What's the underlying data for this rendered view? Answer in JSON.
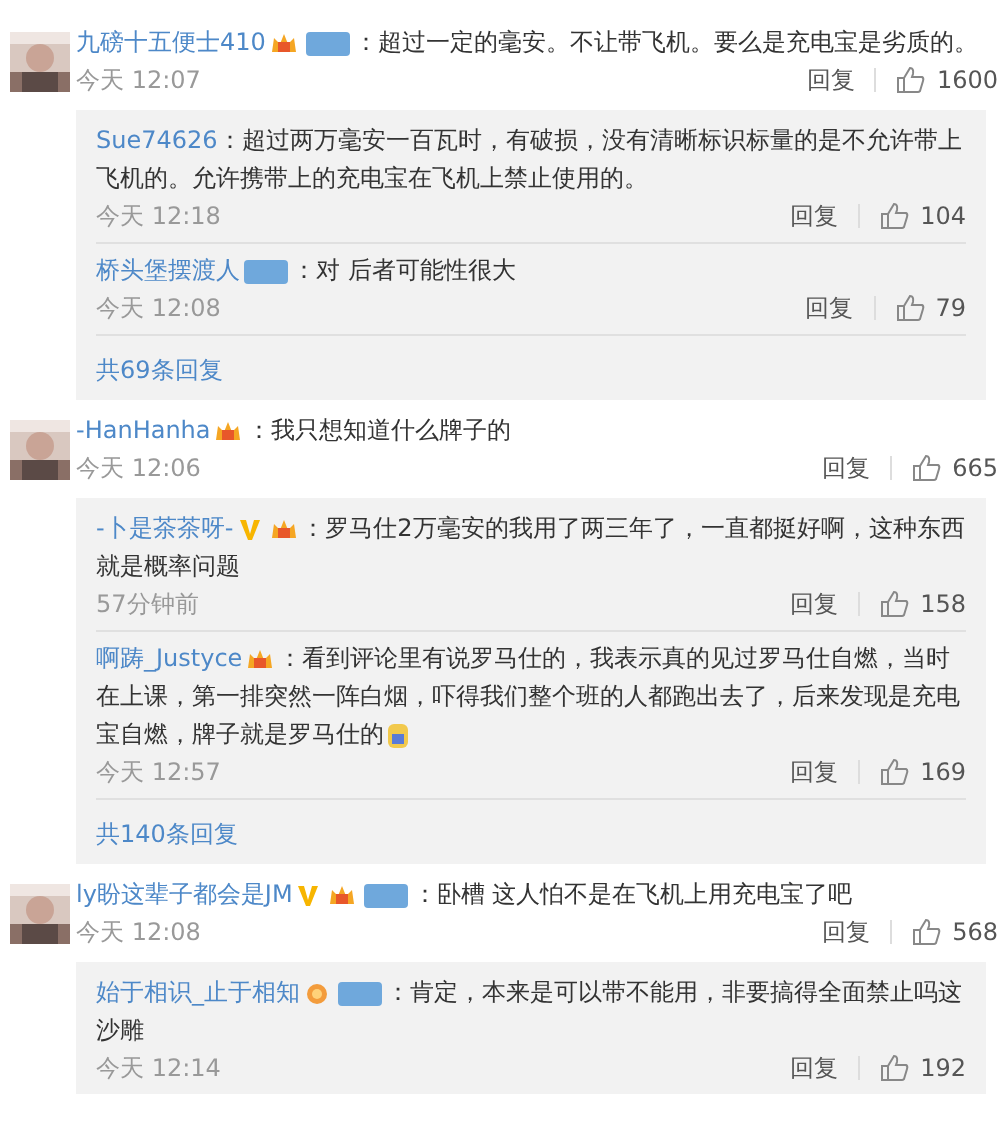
{
  "comments": [
    {
      "user": "九磅十五便士410",
      "badges": [
        {
          "kind": "vip"
        },
        {
          "kind": "fan"
        }
      ],
      "text": "：超过一定的毫安。不让带飞机。要么是充电宝是劣质的。",
      "time": "今天 12:07",
      "reply_label": "回复",
      "likes": "1600",
      "replies": [
        {
          "user": "Sue74626",
          "text": "：超过两万毫安一百瓦时，有破损，没有清晰标识标量的是不允许带上飞机的。允许携带上的充电宝在飞机上禁止使用的。",
          "time": "今天 12:18",
          "reply_label": "回复",
          "likes": "104"
        },
        {
          "user": "桥头堡摆渡人",
          "badges": [
            {
              "kind": "fan"
            }
          ],
          "text": "：对 后者可能性很大",
          "time": "今天 12:08",
          "reply_label": "回复",
          "likes": "79"
        }
      ],
      "more_replies": "共69条回复"
    },
    {
      "user": "-HanHanha",
      "badges": [
        {
          "kind": "vip"
        }
      ],
      "text": "：我只想知道什么牌子的",
      "time": "今天 12:06",
      "reply_label": "回复",
      "likes": "665",
      "replies": [
        {
          "user": "-卜是茶茶呀-",
          "badges": [
            {
              "kind": "verified"
            },
            {
              "kind": "vip"
            }
          ],
          "text": "：罗马仕2万毫安的我用了两三年了，一直都挺好啊，这种东西就是概率问题",
          "time": "57分钟前",
          "reply_label": "回复",
          "likes": "158"
        },
        {
          "user": "啊踌_Justyce",
          "badges": [
            {
              "kind": "vip"
            }
          ],
          "text": "：看到评论里有说罗马仕的，我表示真的见过罗马仕自燃，当时在上课，第一排突然一阵白烟，吓得我们整个班的人都跑出去了，后来发现是充电宝自燃，牌子就是罗马仕的",
          "emoji": true,
          "time": "今天 12:57",
          "reply_label": "回复",
          "likes": "169"
        }
      ],
      "more_replies": "共140条回复"
    },
    {
      "user": "ly盼这辈子都会是JM",
      "badges": [
        {
          "kind": "verified"
        },
        {
          "kind": "vip"
        },
        {
          "kind": "fan"
        }
      ],
      "text": "：卧槽 这人怕不是在飞机上用充电宝了吧",
      "time": "今天 12:08",
      "reply_label": "回复",
      "likes": "568",
      "replies": [
        {
          "user": "始于相识_止于相知",
          "badges": [
            {
              "kind": "medal"
            },
            {
              "kind": "fan"
            }
          ],
          "text": "：肯定，本来是可以带不能用，非要搞得全面禁止吗这沙雕",
          "time": "今天 12:14",
          "reply_label": "回复",
          "likes": "192"
        }
      ]
    }
  ]
}
